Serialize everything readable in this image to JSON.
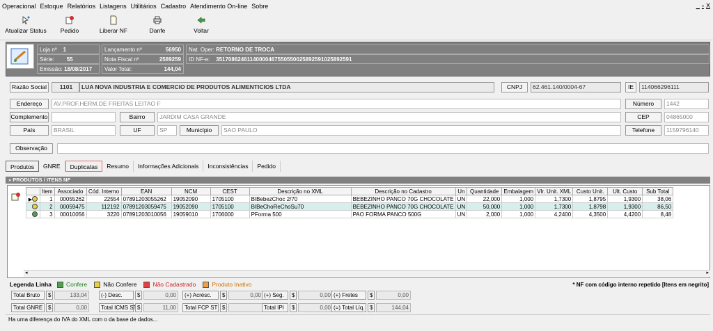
{
  "menu": [
    "Operacional",
    "Estoque",
    "Relatórios",
    "Listagens",
    "Utilitários",
    "Cadastro",
    "Atendimento On-line",
    "Sobre"
  ],
  "window_controls": "_| ̅|X",
  "toolbar": [
    {
      "label": "Atualizar Status",
      "icon": "refresh-status-icon"
    },
    {
      "label": "Pedido",
      "icon": "order-icon"
    },
    {
      "label": "Liberar NF",
      "icon": "document-icon"
    },
    {
      "label": "Danfe",
      "icon": "printer-icon"
    },
    {
      "label": "Voltar",
      "icon": "back-arrow-icon"
    }
  ],
  "info": {
    "loja_label": "Loja nº",
    "loja": "1",
    "serie_label": "Série:",
    "serie": "55",
    "emissao_label": "Emissão:",
    "emissao": "18/08/2017",
    "lanc_label": "Lançamento nº",
    "lanc": "56950",
    "nf_label": "Nota Fiscal nº",
    "nf": "2589259",
    "vt_label": "Valor Total:",
    "vt": "144,04",
    "natop_label": "Nat. Oper:",
    "natop": "RETORNO DE TROCA",
    "idnfe_label": "ID NF-e:",
    "idnfe": "35170862461140000467550550025892591025892591"
  },
  "form": {
    "razao_label": "Razão Social",
    "razao_code": "1101",
    "razao": "LUA NOVA INDUSTRIA E COMERCIO DE PRODUTOS ALIMENTICIOS LTDA",
    "cnpj_label": "CNPJ",
    "cnpj": "62.461.140/0004-67",
    "ie_label": "IE",
    "ie": "114066296111",
    "endereco_label": "Endereço",
    "endereco": "AV.PROF.HERM.DE FREITAS LEITAO F",
    "numero_label": "Número",
    "numero": "1442",
    "complemento_label": "Complemento",
    "complemento": "",
    "bairro_label": "Bairro",
    "bairro": "JARDIM CASA GRANDE",
    "cep_label": "CEP",
    "cep": "04865000",
    "pais_label": "País",
    "pais": "BRASIL",
    "uf_label": "UF",
    "uf": "SP",
    "municipio_label": "Município",
    "municipio": "SAO PAULO",
    "telefone_label": "Telefone",
    "telefone": "1159796140",
    "obs_label": "Observação",
    "obs": ""
  },
  "tabs": [
    "Produtos",
    "GNRE",
    "Duplicatas",
    "Resumo",
    "Informações Adicionais",
    "Inconsistências",
    "Pedido"
  ],
  "section_title": "» PRODUTOS / ITENS NF",
  "grid": {
    "headers": [
      "",
      "Item",
      "Associado",
      "Cód. Interno",
      "EAN",
      "NCM",
      "CEST",
      "Descrição no XML",
      "Descrição no Cadastro",
      "Un",
      "Quantidade",
      "Embalagem",
      "Vlr. Unit. XML",
      "Custo Unit.",
      "Ult. Custo",
      "Sub Total"
    ],
    "rows": [
      [
        "",
        "1",
        "00055262",
        "22554",
        "07891203055262",
        "19052090",
        "1705100",
        "BIBebezChoc 2/70",
        "BEBEZINHO PANCO 70G CHOCOLATE",
        "UN",
        "22,000",
        "1,000",
        "1,7300",
        "1,8795",
        "1,9300",
        "38,06"
      ],
      [
        "",
        "2",
        "00059475",
        "112192",
        "07891203059475",
        "19052090",
        "1705100",
        "BIBeChoReChoSu70",
        "BEBEZINHO PANCO 70G CHOCOLATE",
        "UN",
        "50,000",
        "1,000",
        "1,7300",
        "1,8798",
        "1,9300",
        "86,50"
      ],
      [
        "",
        "3",
        "00010056",
        "3220",
        "07891203010056",
        "19059010",
        "1706000",
        "PForma 500",
        "PAO FORMA PANCO 500G",
        "UN",
        "2,000",
        "1,000",
        "4,2400",
        "4,3500",
        "4,4200",
        "8,48"
      ]
    ],
    "row_status_colors": [
      "#e8d040",
      "#e8d040",
      "#50a050"
    ]
  },
  "legend": {
    "title": "Legenda Linha",
    "items": [
      {
        "label": "Confere",
        "color": "#50a050",
        "text_color": "#208020"
      },
      {
        "label": "Não Confere",
        "color": "#e8d040",
        "text_color": "#000000"
      },
      {
        "label": "Não Cadastrado",
        "color": "#e04040",
        "text_color": "#d02020"
      },
      {
        "label": "Produto Inativo",
        "color": "#f0a040",
        "text_color": "#d07000"
      }
    ],
    "note": "* NF com código interno repetido [Itens em negrito]"
  },
  "totals": {
    "r1": [
      {
        "label": "Total Bruto",
        "cur": "$",
        "value": "133,04"
      },
      {
        "label": "(-) Desc.",
        "cur": "$",
        "value": "0,00"
      },
      {
        "label": "(+) Acrésc.",
        "cur": "$",
        "value": "0,00"
      },
      {
        "label": "(+) Seg.",
        "cur": "$",
        "value": "0,00"
      },
      {
        "label": "(+) Fretes",
        "cur": "$",
        "value": "0,00"
      }
    ],
    "r2": [
      {
        "label": "Total GNRE",
        "cur": "$",
        "value": "0,00"
      },
      {
        "label": "Total ICMS ST",
        "cur": "$",
        "value": "11,00"
      },
      {
        "label": "Total FCP ST",
        "cur": "$",
        "value": ""
      },
      {
        "label": "Total IPI",
        "cur": "$",
        "value": "0,00"
      },
      {
        "label": "(=) Total Líq.",
        "cur": "$",
        "value": "144,04"
      }
    ]
  },
  "status": "Ha uma diferença do IVA do XML com o da base de dados..."
}
